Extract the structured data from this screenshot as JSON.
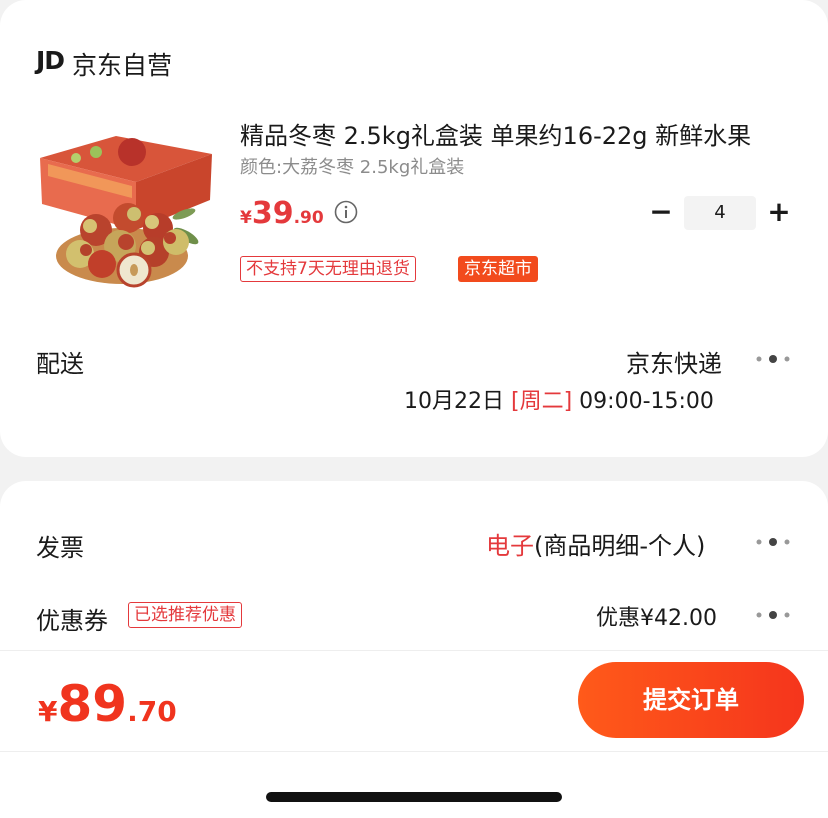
{
  "store": {
    "logo": "JD",
    "name": "京东自营"
  },
  "product": {
    "title": "精品冬枣 2.5kg礼盒装 单果约16-22g 新鲜水果",
    "variant": "颜色:大荔冬枣 2.5kg礼盒装",
    "price_currency": "¥",
    "price_integer": "39",
    "price_decimal": ".90",
    "quantity": "4",
    "minus_label": "−",
    "plus_label": "+",
    "tags": [
      "不支持7天无理由退货",
      "京东超市"
    ]
  },
  "delivery": {
    "label": "配送",
    "method": "京东快递",
    "date": "10月22日",
    "weekday": "[周二]",
    "time_window": "09:00-15:00"
  },
  "invoice": {
    "label": "发票",
    "type": "电子",
    "detail": "(商品明细-个人)"
  },
  "coupon": {
    "label": "优惠券",
    "tag": "已选推荐优惠",
    "value": "优惠¥42.00"
  },
  "total": {
    "currency": "¥",
    "integer": "89",
    "decimal": ".70"
  },
  "submit": {
    "label": "提交订单"
  },
  "colors": {
    "accent": "#e4393c",
    "button": "#f5351c",
    "tag_fill": "#f24b1d"
  },
  "icons": [
    "info-icon",
    "more-dots-icon",
    "minus-icon",
    "plus-icon"
  ]
}
